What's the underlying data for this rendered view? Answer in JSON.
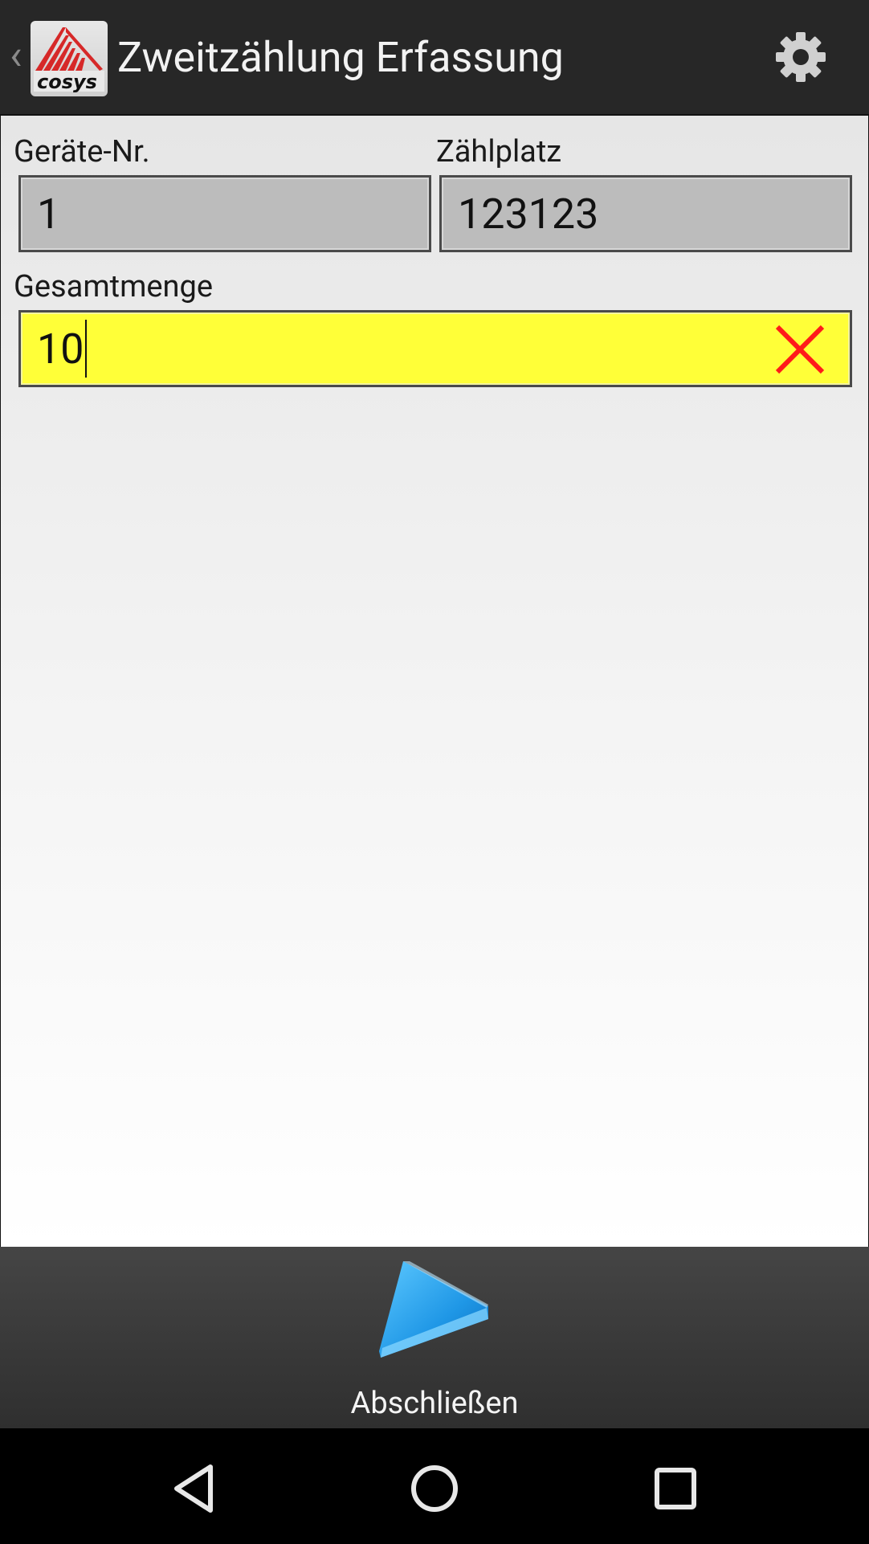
{
  "actionbar": {
    "title": "Zweitzählung Erfassung",
    "back_icon": "chevron-left-icon",
    "logo_icon": "app-logo-icon",
    "settings_icon": "gear-icon"
  },
  "form": {
    "device": {
      "label": "Geräte-Nr.",
      "value": "1"
    },
    "countplace": {
      "label": "Zählplatz",
      "value": "123123"
    },
    "total": {
      "label": "Gesamtmenge",
      "value": "10",
      "clear_icon": "close-icon"
    }
  },
  "bottom": {
    "finish_label": "Abschließen",
    "finish_icon": "play-arrow-icon"
  },
  "navbar": {
    "back_icon": "back-triangle-icon",
    "home_icon": "home-circle-icon",
    "recents_icon": "recents-square-icon"
  },
  "colors": {
    "actionbar_bg": "#272727",
    "field_readonly_bg": "#bcbcbc",
    "field_active_bg": "#ffff38",
    "clear_icon": "#ff1a1a",
    "finish_icon": "#2aa6f0"
  }
}
